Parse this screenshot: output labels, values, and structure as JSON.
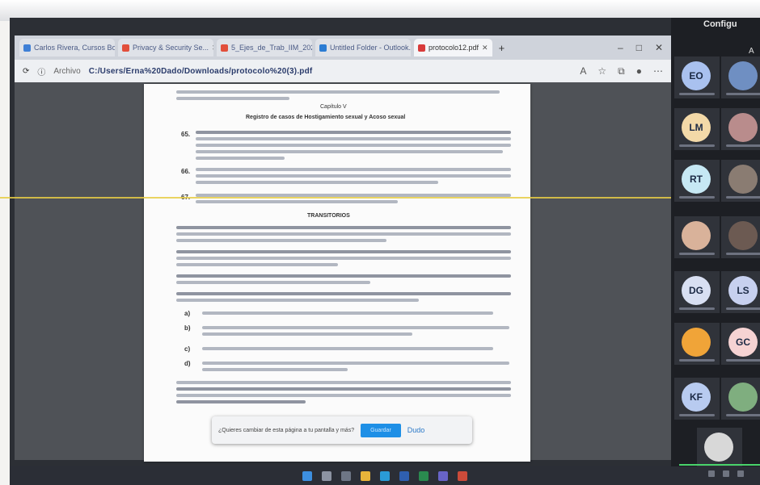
{
  "window": {
    "tabs": [
      {
        "label": "Carlos Rivera, Cursos Bol...",
        "color": "#3e7fd6"
      },
      {
        "label": "Privacy & Security Se...",
        "color": "#e24f3b"
      },
      {
        "label": "5_Ejes_de_Trab_IIM_2025...",
        "color": "#e24f3b"
      },
      {
        "label": "Untitled Folder - Outlook...",
        "color": "#2b7cd3"
      },
      {
        "label": "protocolo12.pdf",
        "color": "#d83b3b"
      }
    ],
    "new_tab": "+",
    "controls": [
      "–",
      "□",
      "✕"
    ]
  },
  "address_bar": {
    "info_label": "Archivo",
    "url": "C:/Users/Erna%20Dado/Downloads/protocolo%20(3).pdf"
  },
  "document": {
    "chapter": "Capítulo V",
    "heading": "Registro de casos de Hostigamiento sexual y Acoso sexual",
    "items": [
      "65.",
      "66.",
      "67."
    ],
    "transitorios": "TRANSITORIOS",
    "lettered": [
      "a)",
      "b)",
      "c)",
      "d)"
    ]
  },
  "save_prompt": {
    "text": "¿Quieres cambiar de esta página a tu pantalla y más?",
    "primary": "Guardar",
    "secondary": "Dudo"
  },
  "conference": {
    "title": "Configu",
    "subtitle": "A",
    "participants": [
      {
        "initials": "EO",
        "color": "#a9c1ef"
      },
      {
        "initials": "",
        "color": "#6f8fc2"
      },
      {
        "initials": "LM",
        "color": "#f3d9a8"
      },
      {
        "initials": "",
        "color": "#b98c8c"
      },
      {
        "initials": "RT",
        "color": "#c6e8f4"
      },
      {
        "initials": "",
        "color": "#8a7c72"
      },
      {
        "initials": "",
        "color": "#d9b29a"
      },
      {
        "initials": "",
        "color": "#6c5a52"
      },
      {
        "initials": "DG",
        "color": "#d8dff2"
      },
      {
        "initials": "LS",
        "color": "#c7d0ef"
      },
      {
        "initials": "",
        "color": "#f0a438"
      },
      {
        "initials": "GC",
        "color": "#f6d3d3"
      },
      {
        "initials": "KF",
        "color": "#b8cbf0"
      },
      {
        "initials": "",
        "color": "#7fae7f"
      },
      {
        "initials": "",
        "color": "#d8d8d8"
      }
    ]
  }
}
